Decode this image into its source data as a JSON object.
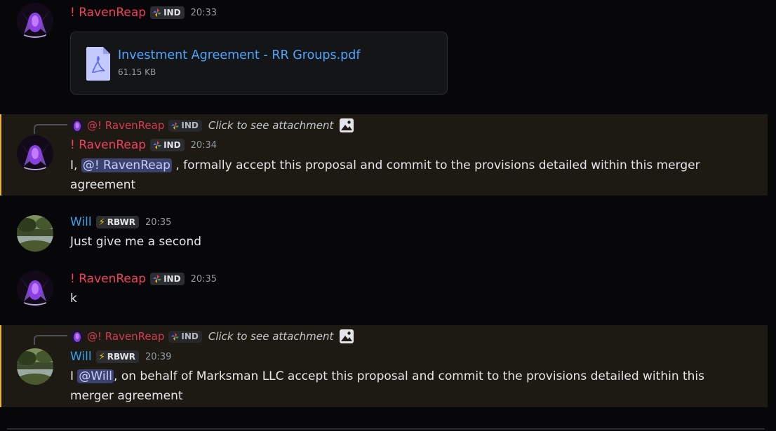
{
  "messages": [
    {
      "author": "! RavenReap",
      "tag": "IND",
      "time": "20:33",
      "attachment": {
        "name": "Investment Agreement - RR Groups.pdf",
        "size": "61.15 KB"
      }
    },
    {
      "reply": {
        "author": "@! RavenReap",
        "tag": "IND",
        "text": "Click to see attachment"
      },
      "author": "! RavenReap",
      "tag": "IND",
      "time": "20:34",
      "text_before": "I, ",
      "mention": "@! RavenReap",
      "text_after_line1": " , formally accept this proposal and commit to the provisions detailed within this merger",
      "text_line2": "agreement"
    },
    {
      "author": "Will",
      "tag": "RBWR",
      "time": "20:35",
      "text": "Just give me a second"
    },
    {
      "author": "! RavenReap",
      "tag": "IND",
      "time": "20:35",
      "text": "k"
    },
    {
      "reply": {
        "author": "@! RavenReap",
        "tag": "IND",
        "text": "Click to see attachment"
      },
      "author": "Will",
      "tag": "RBWR",
      "time": "20:39",
      "text_before": "I ",
      "mention": "@Will",
      "text_after_line1": ", on behalf of Marksman LLC accept this proposal and commit to the provisions detailed within this",
      "text_line2": "merger agreement"
    }
  ],
  "icons": {
    "pdf": "pdf-file-icon",
    "image": "image-icon",
    "tag_ind": "diamond-colors-icon",
    "tag_rbwr": "lightning-icon"
  },
  "colors": {
    "raven_name": "#f23f5f",
    "will_name": "#2fa3ec",
    "highlight_border": "#f0b132",
    "link": "#4ea4ff"
  }
}
